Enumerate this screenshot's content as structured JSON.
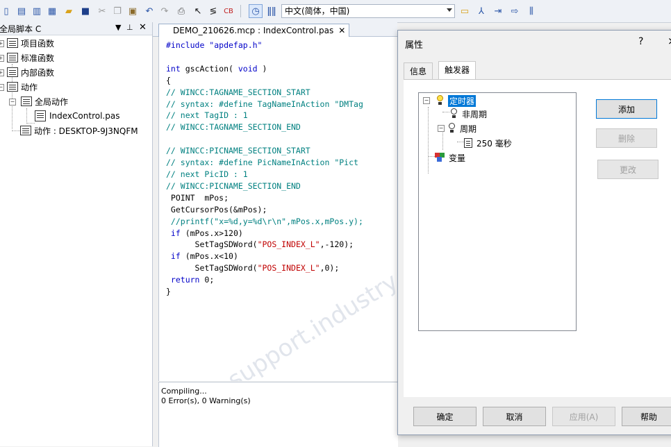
{
  "toolbar": {
    "language_select": "中文(简体，中国)",
    "icons": [
      "new-icon",
      "new-project-icon",
      "open-icon",
      "save-all-icon",
      "folder-open-icon",
      "save-icon",
      "cut-icon",
      "copy-icon",
      "paste-icon",
      "undo-icon",
      "redo-icon",
      "print-icon",
      "help-pointer-icon",
      "tags-icon",
      "c-compile-icon",
      "timer-icon",
      "trigger-icon",
      "folder-icon",
      "info-icon",
      "import-icon",
      "export-icon",
      "bars-icon"
    ]
  },
  "left_panel": {
    "title": "全局脚本 C",
    "tree": {
      "project_functions": "项目函数",
      "standard_functions": "标准函数",
      "internal_functions": "内部函数",
      "actions": "动作",
      "global_actions": "全局动作",
      "index_control": "IndexControl.pas",
      "computer_actions": "动作 : DESKTOP-9J3NQFM"
    }
  },
  "editor": {
    "tab_label": "DEMO_210626.mcp : IndexControl.pas",
    "code": {
      "l1": "#include \"apdefap.h\"",
      "l3a": "int",
      "l3b": " gscAction( ",
      "l3c": "void",
      "l3d": " )",
      "l4": "{",
      "l5": "// WINCC:TAGNAME_SECTION_START",
      "l6": "// syntax: #define TagNameInAction \"DMTag",
      "l7": "// next TagID : 1",
      "l8": "// WINCC:TAGNAME_SECTION_END",
      "l10": "// WINCC:PICNAME_SECTION_START",
      "l11": "// syntax: #define PicNameInAction \"Pict",
      "l12": "// next PicID : 1",
      "l13": "// WINCC:PICNAME_SECTION_END",
      "l14": " POINT  mPos;",
      "l15": " GetCursorPos(&mPos);",
      "l16": " //printf(\"x=%d,y=%d\\r\\n\",mPos.x,mPos.y);",
      "l17a": " if",
      "l17b": " (mPos.x>120)",
      "l18a": "      SetTagSDWord(",
      "l18b": "\"POS_INDEX_L\"",
      "l18c": ",-120);",
      "l19a": " if",
      "l19b": " (mPos.x<10)",
      "l20a": "      SetTagSDWord(",
      "l20b": "\"POS_INDEX_L\"",
      "l20c": ",0);",
      "l21a": " return",
      "l21b": " 0;",
      "l22": "}"
    },
    "watermark": "support.industry.siemens.com/cs"
  },
  "output": {
    "line1": "Compiling...",
    "line2": " 0 Error(s), 0 Warning(s)"
  },
  "dialog": {
    "title": "属性",
    "help": "?",
    "close": "×",
    "tabs": [
      "信息",
      "触发器"
    ],
    "selected_tab": "触发器",
    "tree": {
      "timer": "定时器",
      "acyclic": "非周期",
      "cyclic": "周期",
      "period": "250 毫秒",
      "tag": "变量"
    },
    "side_buttons": {
      "add": "添加",
      "delete": "删除",
      "change": "更改"
    },
    "footer_buttons": {
      "ok": "确定",
      "cancel": "取消",
      "apply": "应用(A)",
      "help": "帮助"
    }
  }
}
